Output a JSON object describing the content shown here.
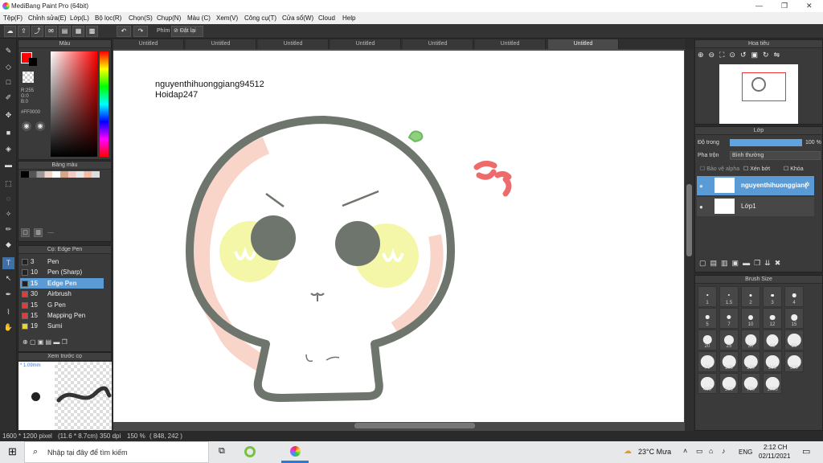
{
  "window": {
    "title": "MediBang Paint Pro (64bit)",
    "controls": [
      "—",
      "❐",
      "✕"
    ]
  },
  "menu": [
    "Tệp(F)",
    "Chỉnh sửa(E)",
    "Lớp(L)",
    "Bộ lọc(R)",
    "Chọn(S)",
    "Chụp(N)",
    "Màu (C)",
    "Xem(V)",
    "Công cụ(T)",
    "Cửa sổ(W)",
    "Cloud",
    "Help"
  ],
  "toolbar": {
    "phim_label": "Phím",
    "reset_label": "Đặt lại"
  },
  "color_panel": {
    "title": "Màu",
    "r": "R:255",
    "g": "G:0",
    "b": "B:0",
    "hex": "#FF0000",
    "fg_color": "#ff0000"
  },
  "palette_panel": {
    "title": "Bảng màu",
    "dash": "----"
  },
  "brush_panel": {
    "title": "Cọ: Edge Pen",
    "items": [
      {
        "size": "3",
        "name": "Pen",
        "color": "#222222"
      },
      {
        "size": "10",
        "name": "Pen (Sharp)",
        "color": "#222222"
      },
      {
        "size": "15",
        "name": "Edge Pen",
        "color": "#222222"
      },
      {
        "size": "30",
        "name": "Airbrush",
        "color": "#e23b3b"
      },
      {
        "size": "15",
        "name": "G Pen",
        "color": "#e23b3b"
      },
      {
        "size": "15",
        "name": "Mapping Pen",
        "color": "#e23b3b"
      },
      {
        "size": "19",
        "name": "Sumi",
        "color": "#e8d43a"
      }
    ]
  },
  "preview_panel": {
    "title": "Xem trước cọ",
    "size": "* 1.09mm"
  },
  "tabs": [
    "Untitled",
    "Untitled",
    "Untitled",
    "Untitled",
    "Untitled",
    "Untitled",
    "Untitled"
  ],
  "canvas": {
    "line1": "nguyenthihuonggiang94512",
    "line2": "Hoidap247"
  },
  "navigator": {
    "title": "Hoa tiêu"
  },
  "layer_panel": {
    "title": "Lớp",
    "opacity_label": "Độ trong",
    "opacity_value": "100 %",
    "opacity_pct": 100,
    "blend_label": "Pha trộn",
    "blend_value": "Bình thường",
    "protect_alpha": "Bảo vệ alpha",
    "clip": "Xén bớt",
    "lock": "Khóa",
    "layers": [
      {
        "name": "nguyenthihuonggiang94512"
      },
      {
        "name": "Lớp1"
      }
    ]
  },
  "brushsize_panel": {
    "title": "Brush Size",
    "sizes": [
      "1",
      "1.5",
      "2",
      "3",
      "4",
      "5",
      "7",
      "10",
      "12",
      "15",
      "20",
      "25",
      "30",
      "40",
      "50",
      "70",
      "100",
      "150",
      "200",
      "300",
      "400",
      "500",
      "700",
      "1000"
    ]
  },
  "status": {
    "pixels": "1600 * 1200 pixel",
    "cm": "(11.6 * 8.7cm)",
    "dpi": "350 dpi",
    "zoom": "150 %",
    "coords": "( 848, 242 )"
  },
  "taskbar": {
    "search": "Nhập tại đây để tìm kiếm",
    "weather": "23°C Mưa",
    "lang": "ENG",
    "time": "2:12 CH",
    "date": "02/11/2021"
  }
}
